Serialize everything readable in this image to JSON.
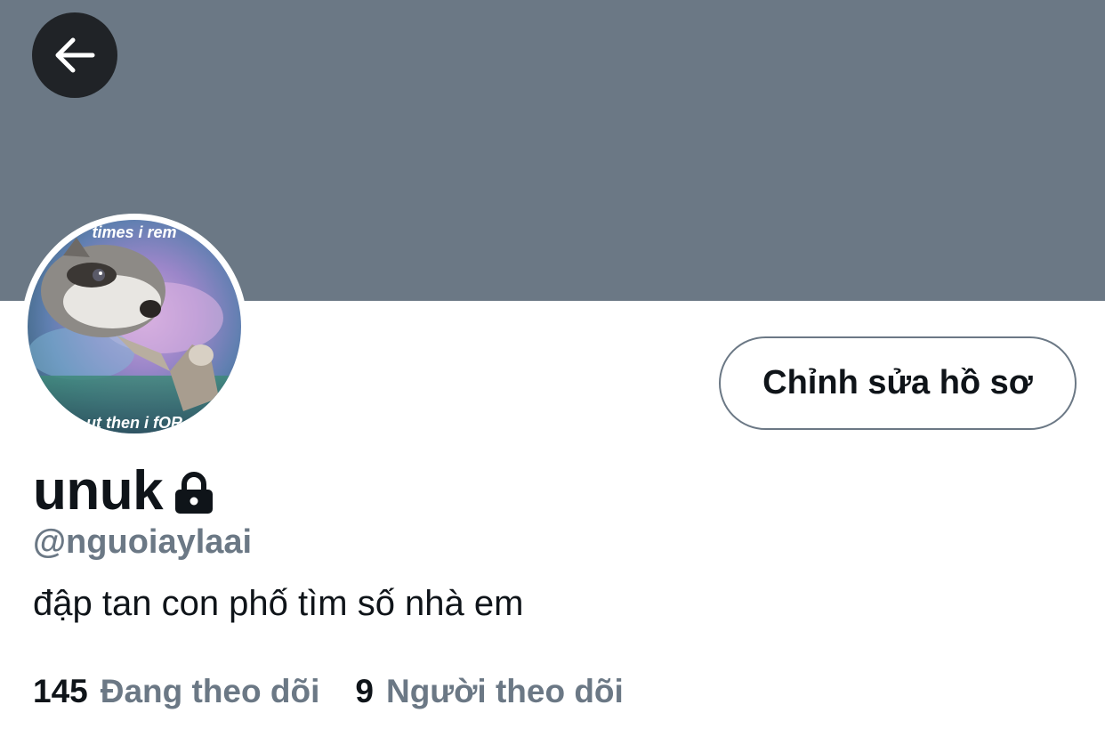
{
  "colors": {
    "banner": "#6b7885",
    "back_button_bg": "#202327",
    "text_primary": "#0f1419",
    "text_secondary": "#6b7885",
    "button_border": "#6b7885"
  },
  "header": {
    "back_icon": "arrow-left-icon"
  },
  "profile": {
    "avatar_caption_top": "times i rem",
    "avatar_caption_bottom": "ut then i fOR",
    "edit_button_label": "Chỉnh sửa hồ sơ",
    "display_name": "unuk",
    "protected_icon": "lock-icon",
    "handle": "@nguoiaylaai",
    "bio": "đập tan con phố tìm số nhà em"
  },
  "stats": {
    "following_count": "145",
    "following_label": "Đang theo dõi",
    "followers_count": "9",
    "followers_label": "Người theo dõi"
  }
}
